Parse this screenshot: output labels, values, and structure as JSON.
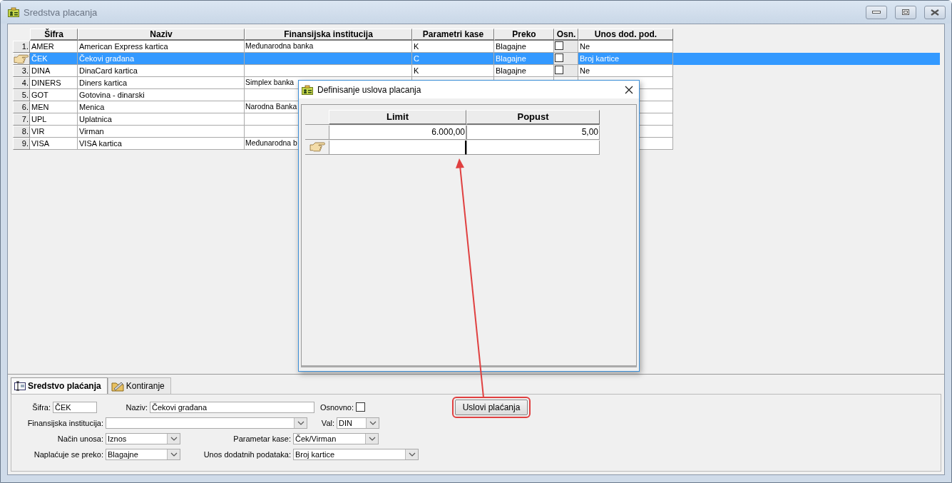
{
  "window": {
    "title": "Sredstva placanja"
  },
  "table": {
    "columns": [
      "Šifra",
      "Naziv",
      "Finansijska institucija",
      "Parametri kase",
      "Preko",
      "Osn.",
      "Unos dod. pod."
    ],
    "rows": [
      {
        "number": "1.",
        "selected": false,
        "cells": [
          "AMER",
          "American Express kartica",
          "Međunarodna banka",
          "K",
          "Blagajne",
          false,
          "Ne"
        ]
      },
      {
        "selected": true,
        "cells": [
          "ČEK",
          "Čekovi građana",
          null,
          "C",
          "Blagajne",
          false,
          "Broj kartice"
        ]
      },
      {
        "number": "3.",
        "selected": false,
        "cells": [
          "DINA",
          "DinaCard kartica",
          null,
          "K",
          "Blagajne",
          false,
          "Ne"
        ]
      },
      {
        "number": "4.",
        "selected": false,
        "cells": [
          "DINERS",
          "Diners kartica",
          "Simplex banka"
        ]
      },
      {
        "number": "5.",
        "selected": false,
        "cells": [
          "GOT",
          "Gotovina - dinarski",
          null
        ]
      },
      {
        "number": "6.",
        "selected": false,
        "cells": [
          "MEN",
          "Menica",
          "Narodna Banka"
        ]
      },
      {
        "number": "7.",
        "selected": false,
        "cells": [
          "UPL",
          "Uplatnica",
          null
        ]
      },
      {
        "number": "8.",
        "selected": false,
        "cells": [
          "VIR",
          "Virman",
          null
        ]
      },
      {
        "number": "9.",
        "selected": false,
        "cells": [
          "VISA",
          "VISA kartica",
          "Međunarodna b"
        ]
      }
    ]
  },
  "dialog": {
    "title": "Definisanje uslova placanja",
    "columns": [
      "Limit",
      "Popust"
    ],
    "rows": [
      {
        "selected": false,
        "cells": [
          "6.000,00",
          "5,00"
        ]
      },
      {
        "selected": true,
        "cells": [
          null,
          null
        ]
      }
    ]
  },
  "tabs": [
    {
      "label": "Sredstvo plaćanja",
      "selected": true
    },
    {
      "label": "Kontiranje",
      "selected": false
    }
  ],
  "form": {
    "rows": [
      [
        {
          "kind": "text",
          "label": "Šifra:",
          "value": "ČEK"
        },
        {
          "kind": "text",
          "label": "Naziv:",
          "value": "Čekovi građana"
        },
        {
          "kind": "checkbox",
          "label": "Osnovno:",
          "checked": false
        },
        {
          "kind": "button",
          "label": "Uslovi plaćanja",
          "highlighted": true
        }
      ],
      [
        {
          "kind": "combo",
          "label": "Finansijska institucija:"
        },
        {
          "kind": "combo",
          "label": "Val:",
          "value": "DIN"
        }
      ],
      [
        {
          "kind": "combo",
          "label": "Način unosa:",
          "value": "Iznos"
        },
        {
          "kind": "combo",
          "label": "Parametar kase:",
          "value": "Ček/Virman"
        }
      ],
      [
        {
          "kind": "combo",
          "label": "Naplaćuje se preko:",
          "value": "Blagajne"
        },
        {
          "kind": "combo",
          "label": "Unos dodatnih podataka:",
          "value": "Broj kartice"
        }
      ]
    ]
  }
}
